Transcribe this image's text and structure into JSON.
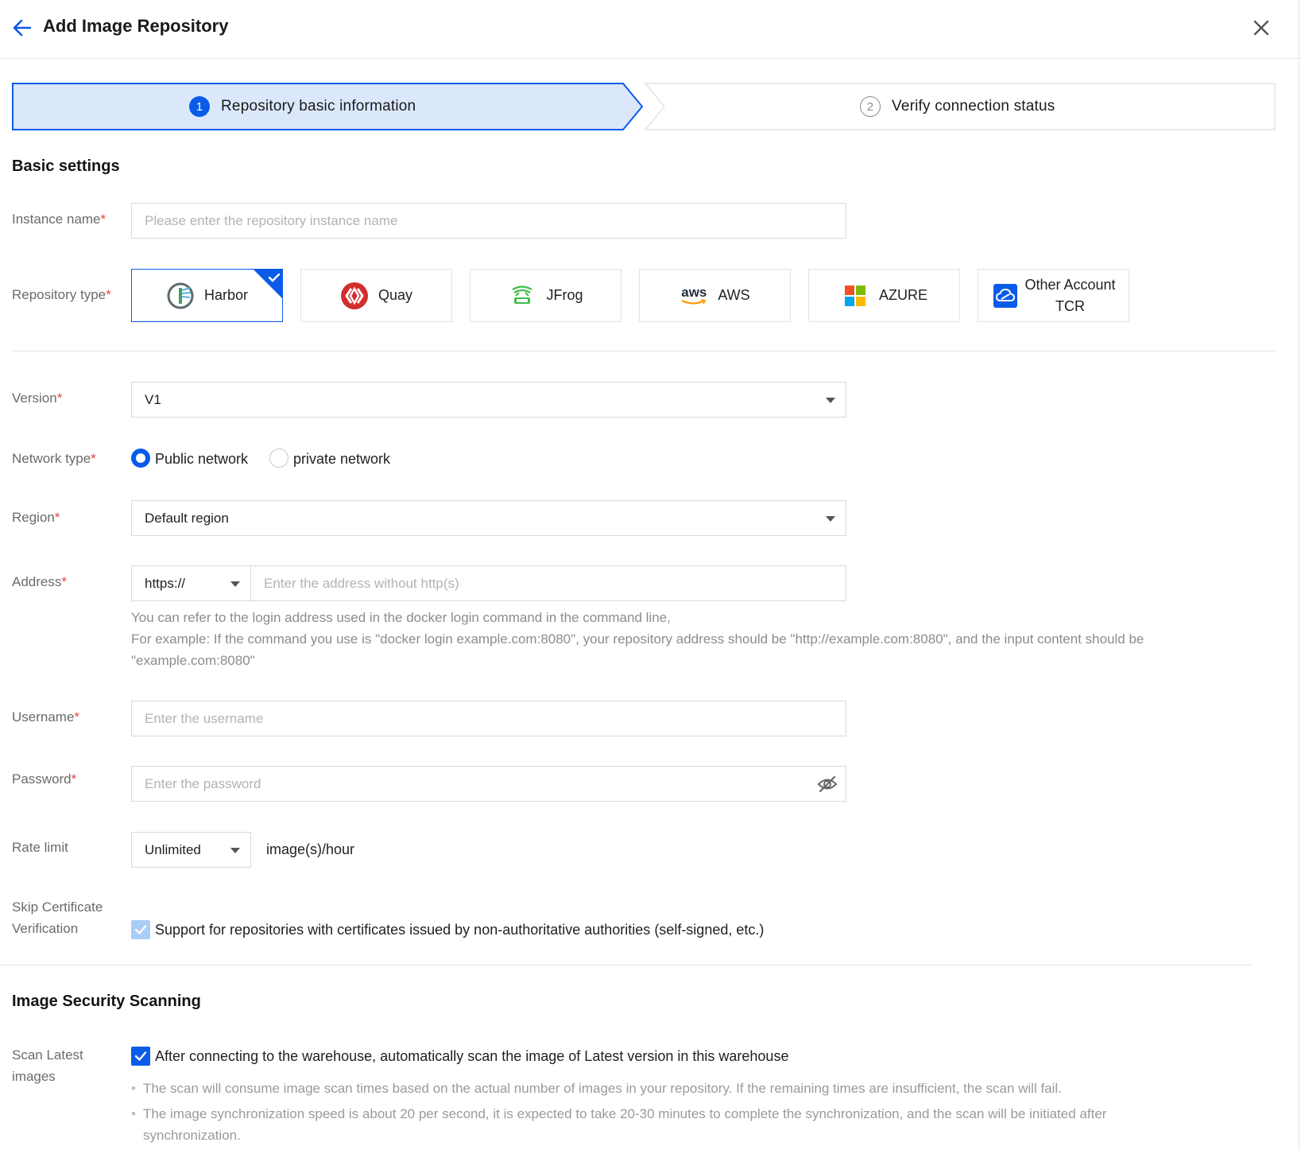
{
  "header": {
    "title": "Add Image Repository"
  },
  "steps": [
    {
      "num": "1",
      "label": "Repository basic information"
    },
    {
      "num": "2",
      "label": "Verify connection status"
    }
  ],
  "basic_settings": {
    "title": "Basic settings",
    "instance_name": {
      "label": "Instance name",
      "required": "*",
      "placeholder": "Please enter the repository instance name"
    },
    "repository_type": {
      "label": "Repository type",
      "required": "*",
      "options": [
        {
          "name": "Harbor",
          "selected": true
        },
        {
          "name": "Quay"
        },
        {
          "name": "JFrog"
        },
        {
          "name": "AWS",
          "logo_text": "aws"
        },
        {
          "name": "AZURE"
        },
        {
          "name_line1": "Other Account",
          "name_line2": "TCR"
        }
      ]
    },
    "version": {
      "label": "Version",
      "required": "*",
      "value": "V1"
    },
    "network_type": {
      "label": "Network type",
      "required": "*",
      "options": [
        "Public network",
        "private network"
      ],
      "selected": "Public network"
    },
    "region": {
      "label": "Region",
      "required": "*",
      "value": "Default region"
    },
    "address": {
      "label": "Address",
      "required": "*",
      "protocol": "https://",
      "placeholder": "Enter the address without http(s)",
      "help_line1": "You can refer to the login address used in the docker login command in the command line,",
      "help_line2": "For example: If the command you use is \"docker login example.com:8080\", your repository address should be \"http://example.com:8080\", and the input content should be",
      "help_line3": "\"example.com:8080\""
    },
    "username": {
      "label": "Username",
      "required": "*",
      "placeholder": "Enter the username"
    },
    "password": {
      "label": "Password",
      "required": "*",
      "placeholder": "Enter the password"
    },
    "rate_limit": {
      "label": "Rate limit",
      "value": "Unlimited",
      "unit": "image(s)/hour"
    },
    "skip_cert": {
      "label_line1": "Skip Certificate",
      "label_line2": "Verification",
      "text": "Support for repositories with certificates issued by non-authoritative authorities (self-signed, etc.)",
      "checked": true,
      "disabled": true
    }
  },
  "security_scanning": {
    "title": "Image Security Scanning",
    "scan_latest": {
      "label_line1": "Scan Latest",
      "label_line2": "images",
      "text": "After connecting to the warehouse, automatically scan the image of Latest version in this warehouse",
      "checked": true
    },
    "note1": "The scan will consume image scan times based on the actual number of images in your repository. If the remaining times are insufficient, the scan will fail.",
    "note2_line1": "The image synchronization speed is about 20 per second, it is expected to take 20-30 minutes to complete the synchronization, and the scan will be initiated after",
    "note2_line2": "synchronization."
  },
  "colors": {
    "primary": "#0a5be8",
    "step_active_bg": "#dbe8fc",
    "required": "#e54545"
  },
  "icons": [
    "arrow-left-icon",
    "close-icon",
    "harbor-logo-icon",
    "quay-logo-icon",
    "jfrog-logo-icon",
    "aws-logo-icon",
    "azure-logo-icon",
    "tcr-cloud-icon",
    "checkmark-icon",
    "eye-off-icon",
    "chevron-down-icon"
  ]
}
